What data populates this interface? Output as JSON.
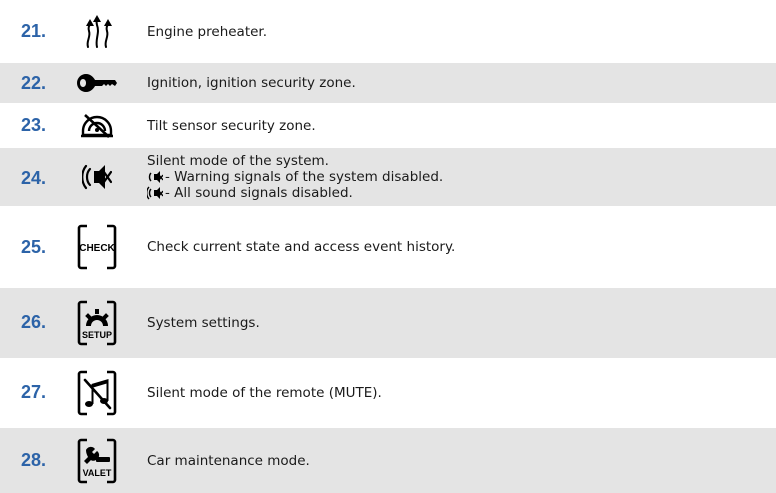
{
  "rows": [
    {
      "number": "21.",
      "icon": "engine-preheater-icon",
      "text": "Engine preheater."
    },
    {
      "number": "22.",
      "icon": "ignition-key-icon",
      "text": "Ignition, ignition security zone."
    },
    {
      "number": "23.",
      "icon": "tilt-sensor-icon",
      "text": "Tilt sensor security zone."
    },
    {
      "number": "24.",
      "icon": "silent-mode-icon",
      "lines": [
        "Silent mode of the system.",
        "- Warning signals of the system disabled.",
        "- All sound signals disabled."
      ]
    },
    {
      "number": "25.",
      "icon": "check-button-icon",
      "icon_label": "CHECK",
      "text": "Check current state and access event history."
    },
    {
      "number": "26.",
      "icon": "setup-button-icon",
      "icon_label": "SETUP",
      "text": "System settings."
    },
    {
      "number": "27.",
      "icon": "mute-button-icon",
      "text": "Silent mode of the remote (MUTE)."
    },
    {
      "number": "28.",
      "icon": "valet-button-icon",
      "icon_label": "VALET",
      "text": "Car maintenance mode."
    }
  ],
  "colors": {
    "number": "#2c63a8",
    "shade": "#e4e4e4",
    "text": "#1a1a1a"
  }
}
